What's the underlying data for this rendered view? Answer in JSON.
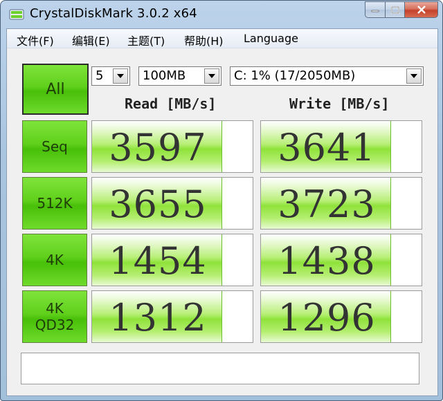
{
  "window": {
    "title": "CrystalDiskMark 3.0.2 x64",
    "icons": {
      "app": "crystaldiskmark-icon",
      "minimize": "minimize-icon",
      "maximize": "maximize-icon",
      "close": "close-icon"
    }
  },
  "menu": {
    "file": "文件(F)",
    "edit": "编辑(E)",
    "theme": "主题(T)",
    "help": "帮助(H)",
    "language": "Language"
  },
  "controls": {
    "all_label": "All",
    "runs_value": "5",
    "size_value": "100MB",
    "drive_value": "C: 1% (17/2050MB)"
  },
  "headers": {
    "read": "Read [MB/s]",
    "write": "Write [MB/s]"
  },
  "tests": [
    {
      "label_line1": "Seq",
      "label_line2": "",
      "read": "3597",
      "write": "3641",
      "read_fill": 0.81,
      "write_fill": 0.81
    },
    {
      "label_line1": "512K",
      "label_line2": "",
      "read": "3655",
      "write": "3723",
      "read_fill": 0.81,
      "write_fill": 0.81
    },
    {
      "label_line1": "4K",
      "label_line2": "",
      "read": "1454",
      "write": "1438",
      "read_fill": 0.81,
      "write_fill": 0.81
    },
    {
      "label_line1": "4K",
      "label_line2": "QD32",
      "read": "1312",
      "write": "1296",
      "read_fill": 0.81,
      "write_fill": 0.81
    }
  ],
  "comment": "",
  "colors": {
    "button_green": "#5fd01b",
    "bar_green": "#8fe23a"
  }
}
